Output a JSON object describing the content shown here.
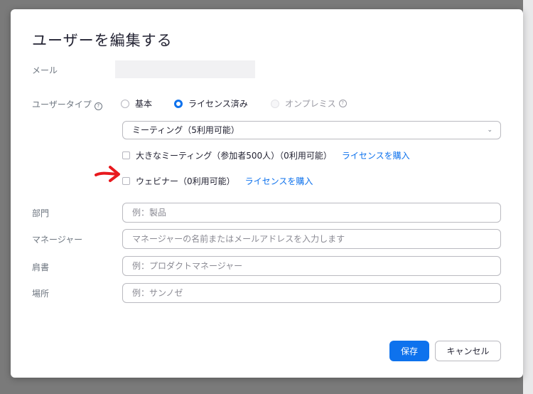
{
  "dialog": {
    "title": "ユーザーを編集する"
  },
  "email": {
    "label": "メール"
  },
  "user_type": {
    "label": "ユーザータイプ",
    "options": [
      {
        "label": "基本",
        "state": "unselected"
      },
      {
        "label": "ライセンス済み",
        "state": "selected"
      },
      {
        "label": "オンプレミス",
        "state": "disabled"
      }
    ]
  },
  "meeting_select": {
    "value": "ミーティング（5利用可能）"
  },
  "large_meeting": {
    "label": "大きなミーティング（参加者500人）（0利用可能）",
    "link": "ライセンスを購入"
  },
  "webinar": {
    "label": "ウェビナー（0利用可能）",
    "link": "ライセンスを購入"
  },
  "fields": {
    "department": {
      "label": "部門",
      "placeholder": "例：製品"
    },
    "manager": {
      "label": "マネージャー",
      "placeholder": "マネージャーの名前またはメールアドレスを入力します"
    },
    "title": {
      "label": "肩書",
      "placeholder": "例：プロダクトマネージャー"
    },
    "location": {
      "label": "場所",
      "placeholder": "例：サンノゼ"
    }
  },
  "buttons": {
    "save": "保存",
    "cancel": "キャンセル"
  },
  "colors": {
    "accent": "#0e72ed",
    "annotation": "#e8191e"
  }
}
